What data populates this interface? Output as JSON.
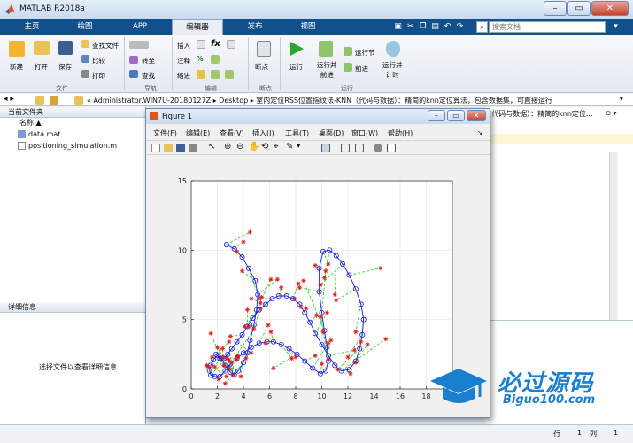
{
  "window": {
    "title": "MATLAB R2018a"
  },
  "tabs": [
    "主页",
    "绘图",
    "APP",
    "编辑器",
    "发布",
    "视图"
  ],
  "search": {
    "placeholder": "搜索文档"
  },
  "ribbon": {
    "file": {
      "new": "新建",
      "open": "打开",
      "save": "保存",
      "find_files": "查找文件",
      "compare": "比较",
      "print": "打印",
      "group": "文件"
    },
    "nav": {
      "goto": "转至",
      "find": "查找",
      "group": "导航"
    },
    "edit": {
      "insert": "插入",
      "fx": "fx",
      "comment": "注释",
      "indent": "缩进",
      "group": "编辑"
    },
    "breakpoints": {
      "label": "断点",
      "group": "断点"
    },
    "run": {
      "run": "运行",
      "run_advance": "运行并\n前进",
      "run_section": "运行节",
      "advance": "前进",
      "run_time": "运行并\n计时",
      "group": "运行"
    }
  },
  "address": {
    "path": "« Administrator.WIN7U-20180127Z ▸ Desktop ▸ 室内定位RSS位置指纹法-KNN（代码与数据）：精简的knn定位算法，包含数据集，可直接运行"
  },
  "current_folder": {
    "title": "当前文件夹",
    "column": "名称 ▲",
    "files": [
      "data.mat",
      "positioning_simulation.m"
    ]
  },
  "details": {
    "title": "详细信息",
    "hint": "选择文件以查看详细信息"
  },
  "editor_tab": {
    "text": "(代码与数据）：精简的knn定位..."
  },
  "status": {
    "row_label": "行",
    "row": "1",
    "col_label": "列",
    "col": "1"
  },
  "figure": {
    "title": "Figure 1",
    "menus": [
      "文件(F)",
      "编辑(E)",
      "查看(V)",
      "插入(I)",
      "工具(T)",
      "桌面(D)",
      "窗口(W)",
      "帮助(H)"
    ]
  },
  "watermark": {
    "cn": "必过源码",
    "url": "Biguo100.com"
  },
  "colors": {
    "accent": "#11508b",
    "true_path": "#1a1aee",
    "estimate": "#e21b1b",
    "error_line": "#1fd01f"
  },
  "chart_data": {
    "type": "line",
    "xlim": [
      0,
      20
    ],
    "ylim": [
      0,
      15
    ],
    "xticks": [
      0,
      2,
      4,
      6,
      8,
      10,
      12,
      14,
      16,
      18,
      20
    ],
    "yticks": [
      0,
      5,
      10,
      15
    ],
    "grid": true,
    "series": [
      {
        "marker": "circle",
        "style": "solid",
        "color": "#1a1aee",
        "x": [
          2.7,
          3.3,
          3.9,
          4.4,
          4.9,
          5.1,
          5.0,
          4.8,
          4.5,
          4.3,
          4.0,
          3.6,
          3.3,
          3.0,
          2.6,
          2.3,
          2.0,
          1.7,
          1.5,
          1.4,
          1.5,
          1.8,
          2.2,
          2.6,
          3.0,
          3.5,
          4.0,
          4.6,
          5.2,
          5.8,
          6.3,
          6.9,
          7.5,
          8.1,
          8.7,
          9.3,
          9.9,
          10.3,
          10.5,
          10.4,
          10.2,
          10.0,
          9.8,
          9.8,
          10.1,
          10.6,
          11.1,
          11.6,
          12.1,
          12.6,
          13.0,
          13.2,
          13.1,
          12.9,
          12.6,
          12.1,
          11.5,
          11.0,
          10.5,
          10.0,
          9.5,
          9.1,
          8.7,
          8.3,
          7.8,
          7.3,
          6.7,
          6.2,
          5.7,
          5.2,
          4.7,
          4.3,
          3.9,
          3.5,
          3.1,
          2.8,
          2.5,
          2.2,
          1.9
        ],
        "y": [
          10.4,
          10.1,
          9.5,
          8.7,
          7.8,
          6.8,
          5.7,
          4.6,
          3.5,
          2.6,
          1.9,
          1.3,
          1.0,
          1.2,
          1.7,
          2.2,
          2.4,
          2.1,
          1.7,
          1.3,
          1.0,
          0.9,
          0.9,
          1.3,
          1.8,
          2.2,
          2.6,
          3.0,
          3.3,
          3.4,
          3.4,
          3.2,
          2.9,
          2.5,
          2.0,
          1.5,
          1.1,
          1.3,
          2.0,
          3.0,
          4.2,
          5.5,
          7.0,
          8.7,
          9.9,
          10.0,
          9.6,
          9.0,
          8.2,
          7.2,
          6.1,
          5.0,
          3.9,
          2.9,
          2.0,
          1.4,
          1.3,
          1.7,
          2.4,
          3.2,
          4.0,
          4.8,
          5.5,
          6.1,
          6.5,
          6.7,
          6.7,
          6.5,
          6.1,
          5.7,
          5.1,
          4.5,
          3.9,
          3.4,
          2.9,
          2.5,
          2.2,
          2.2,
          2.5
        ]
      },
      {
        "marker": "star",
        "style": "dashed",
        "color": "#e21b1b",
        "x": [
          4.5,
          4.0,
          3.5,
          5.2,
          3.9,
          6.6,
          6.1,
          4.4,
          5.3,
          3.1,
          2.6,
          1.6,
          2.9,
          3.5,
          2.4,
          1.5,
          2.9,
          1.2,
          2.7,
          2.1,
          2.7,
          1.3,
          3.6,
          2.5,
          4.8,
          2.4,
          3.8,
          4.2,
          5.9,
          5.7,
          6.1,
          7.7,
          8.0,
          6.3,
          9.5,
          10.5,
          10.0,
          10.5,
          10.1,
          9.9,
          8.6,
          10.3,
          8.3,
          9.5,
          10.5,
          10.2,
          11.0,
          9.9,
          14.5,
          11.1,
          12.6,
          13.0,
          12.0,
          11.2,
          12.6,
          13.5,
          14.9,
          12.2,
          12.5,
          10.7,
          10.4,
          9.6,
          8.4,
          8.8,
          8.2,
          7.9,
          6.9,
          5.4,
          4.6,
          4.1,
          5.3,
          4.3,
          3.0,
          4.6,
          3.5,
          3.2,
          2.0,
          1.8,
          2.9
        ],
        "y": [
          11.3,
          10.6,
          9.9,
          6.5,
          8.5,
          7.9,
          7.9,
          4.5,
          5.8,
          1.9,
          0.4,
          2.3,
          2.1,
          2.1,
          2.9,
          4.0,
          1.5,
          1.7,
          0.9,
          0.7,
          2.2,
          1.6,
          2.4,
          1.7,
          4.3,
          2.3,
          0.9,
          2.2,
          4.6,
          3.3,
          4.1,
          2.2,
          2.3,
          1.5,
          2.4,
          3.3,
          1.8,
          2.1,
          4.1,
          5.2,
          7.8,
          8.5,
          7.3,
          8.9,
          9.0,
          8.0,
          6.8,
          7.5,
          8.7,
          6.4,
          4.1,
          3.4,
          2.3,
          1.4,
          1.9,
          3.2,
          3.6,
          1.1,
          2.8,
          3.5,
          5.5,
          5.3,
          5.9,
          5.8,
          7.6,
          6.5,
          7.3,
          6.6,
          6.5,
          4.5,
          6.2,
          5.7,
          3.8,
          2.6,
          2.3,
          1.0,
          3.0,
          1.6,
          3.4
        ]
      }
    ]
  }
}
